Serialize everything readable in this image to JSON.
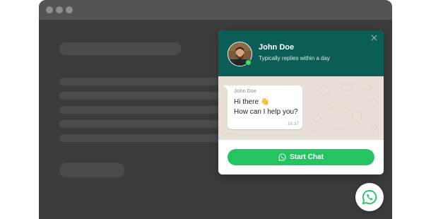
{
  "chat_widget": {
    "agent_name": "John Doe",
    "agent_status": "Typically replies within a day",
    "close_icon": "close-icon",
    "message": {
      "sender": "John Doe",
      "line1": "Hi there 👋",
      "line2": "How can I help you?",
      "time": "16:37"
    },
    "start_button_label": "Start Chat",
    "start_button_icon": "whatsapp-icon"
  },
  "launcher": {
    "icon": "whatsapp-icon"
  },
  "colors": {
    "header": "#0b5e55",
    "button": "#25c462",
    "online": "#4ade50",
    "page_background": "#3b3c3c"
  }
}
